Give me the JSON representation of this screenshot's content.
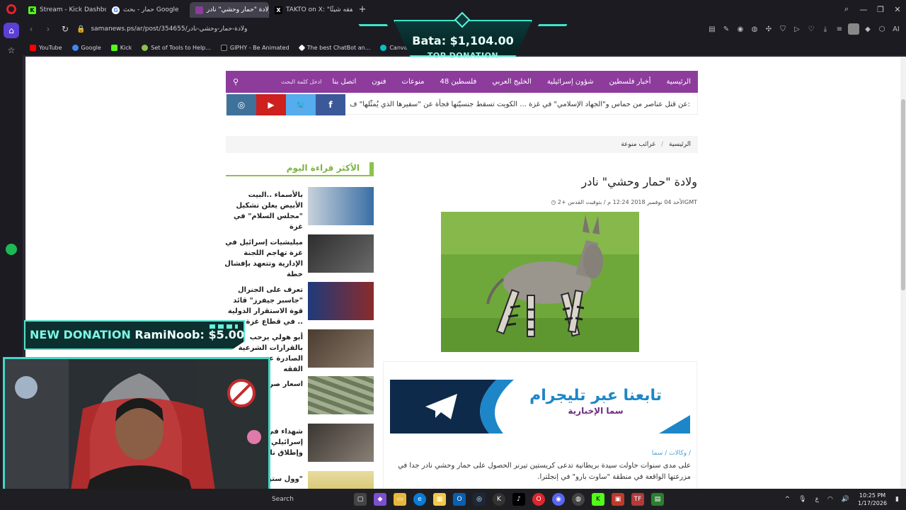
{
  "browser": {
    "tabs": [
      {
        "label": "Stream - Kick Dashboard",
        "icon": "kick-icon",
        "color": "#53fc18",
        "active": false
      },
      {
        "label": "حمار - بحث Google",
        "icon": "google-icon",
        "color": "#ffffff",
        "active": false
      },
      {
        "label": "ولادة \"حمار وحشي\" نادر - ...",
        "icon": "page-icon",
        "color": "#8d3c9c",
        "active": true
      },
      {
        "label": "TAKTO on X: \"لا يفقه شيئًا",
        "icon": "x-icon",
        "color": "#000000",
        "active": false
      }
    ],
    "url": "samanews.ps/ar/post/354655/ولادة-حمار-وحشي-نادر",
    "bookmarks": [
      {
        "label": "YouTube",
        "color": "#ff0000"
      },
      {
        "label": "Google",
        "color": "#4285f4"
      },
      {
        "label": "Kick",
        "color": "#53fc18"
      },
      {
        "label": "Set of Tools to Help...",
        "color": "#8bc34a"
      },
      {
        "label": "GIPHY - Be Animated",
        "color": "#111111"
      },
      {
        "label": "The best ChatBot an...",
        "color": "#ffffff"
      },
      {
        "label": "Canva",
        "color": "#00c4cc"
      }
    ],
    "ext_ai_label": "AI"
  },
  "site": {
    "nav_items": [
      "الرئيسية",
      "أخبار فلسطين",
      "شؤون إسرائيلية",
      "الخليج العربي",
      "فلسطين 48",
      "منوعات",
      "فنون",
      "اتصل بنا"
    ],
    "search_placeholder": "ادخل كلمة البحث",
    "ticker": ":عن قتل عناصر من حماس و\"الجهاد الإسلامي\" في غزة ...  الكويت تسقط جنسيّتها فجأة عن \"سفيرها الذي يُمثّلها\" ف",
    "social_colors": {
      "instagram": "#3f729b",
      "youtube": "#cd201f",
      "twitter": "#55acee",
      "facebook": "#3b5998"
    },
    "accent": "#8d3c9c"
  },
  "breadcrumb": {
    "home": "الرئيسية",
    "section": "غرائب منوعة"
  },
  "article": {
    "title": "ولادة \"حمار وحشي\" نادر",
    "meta": "الأحد 04 نوفمبر 2018 12:24 م / بتوقيت القدس +2GMT",
    "telegram_line1": "تابعنا عبر تليجرام",
    "telegram_line2": "سما الإخبارية",
    "source": "وكالات / سما /",
    "body": "على مدى سنوات حاولت سيدة بريطانية تدعى كريستين تيرنر الحصول على حمار وحشي نادر جدا في مزرعتها الواقعة في منطقة \"ساوث بارو\" في إنجلترا."
  },
  "most_read": {
    "heading": "الأكثر قراءة اليوم",
    "items": [
      {
        "title": "بالأسماء ..البيت الأبيض يعلن تشكيل \"مجلس السلام\" في غزة",
        "thumb": "#3a6ea5"
      },
      {
        "title": "ميليشيات إسرائيل في غزة تهاجم اللجنة الإدارية وتتعهد بإفشال خطة",
        "thumb": "#4a4a4a"
      },
      {
        "title": "تعرف على الجنرال \"جاسبر جيفرز\" قائد قوة الاستقرار الدولية في قطاع غزة ..",
        "thumb": "#8b2b2b"
      },
      {
        "title": "أبو هولي يرحب بالقرارات الشرعية الصادرة عن مجمع الفقه",
        "thumb": "#6b5a4a"
      },
      {
        "title": "اسعار صرف العملات",
        "thumb": "#7d8a6a"
      },
      {
        "title": "شهداء في قصف إسرائيلي شرقي غزة وإطلاق نار",
        "thumb": "#5a5550"
      },
      {
        "title": "\"وول ستريت\"",
        "thumb": "#c9b54a"
      }
    ]
  },
  "stream": {
    "top_donation_amount": "Bata: $1,104.00",
    "top_donation_label": "TOP DONATION",
    "new_donation_label": "NEW DONATION",
    "new_donation_text": "RamiNoob: $5.00"
  },
  "taskbar": {
    "search": "Search",
    "time": "10:25 PM",
    "date": "1/17/2026",
    "lang": "ع"
  }
}
